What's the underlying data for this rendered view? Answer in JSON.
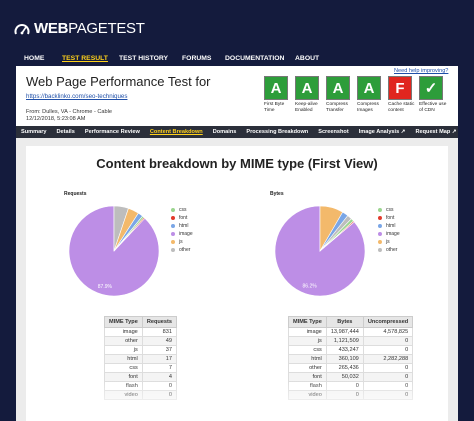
{
  "header": {
    "logo_text_web": "WEB",
    "logo_text_pagetest": "PAGETEST",
    "nav": [
      "HOME",
      "TEST RESULT",
      "TEST HISTORY",
      "FORUMS",
      "DOCUMENTATION",
      "ABOUT"
    ],
    "nav_active_index": 1
  },
  "test": {
    "title": "Web Page Performance Test for",
    "url": "https://backlinko.com/seo-techniques",
    "from_line1": "From: Dulles, VA - Chrome - Cable",
    "from_line2": "12/12/2018, 5:23:08 AM",
    "help_link": "Need help improving?"
  },
  "grades": [
    {
      "letter": "A",
      "label": "First Byte Time",
      "color": "#2d9d3a"
    },
    {
      "letter": "A",
      "label": "Keep-alive Enabled",
      "color": "#2d9d3a"
    },
    {
      "letter": "A",
      "label": "Compress Transfer",
      "color": "#2d9d3a"
    },
    {
      "letter": "A",
      "label": "Compress Images",
      "color": "#2d9d3a"
    },
    {
      "letter": "F",
      "label": "Cache static content",
      "color": "#e0261f"
    },
    {
      "letter": "✓",
      "label": "Effective use of CDN",
      "color": "#2d9d3a"
    }
  ],
  "subnav": [
    "Summary",
    "Details",
    "Performance Review",
    "Content Breakdown",
    "Domains",
    "Processing Breakdown",
    "Screenshot",
    "Image Analysis ↗",
    "Request Map ↗"
  ],
  "subnav_active_index": 3,
  "page_title": "Content breakdown by MIME type (First View)",
  "colors": {
    "css": "#9bd58f",
    "font": "#e23a2c",
    "html": "#7aa6e6",
    "image": "#bd8ee6",
    "js": "#f3b96b",
    "other": "#bdbdbd"
  },
  "legend": [
    "css",
    "font",
    "html",
    "image",
    "js",
    "other"
  ],
  "chart_data": [
    {
      "type": "pie",
      "title": "Requests",
      "slices": [
        {
          "label": "image",
          "value": 87.9,
          "shown": "87.9%"
        },
        {
          "label": "other",
          "value": 5.2
        },
        {
          "label": "js",
          "value": 3.9
        },
        {
          "label": "html",
          "value": 1.8
        },
        {
          "label": "css",
          "value": 0.7
        },
        {
          "label": "font",
          "value": 0.4
        }
      ]
    },
    {
      "type": "pie",
      "title": "Bytes",
      "slices": [
        {
          "label": "image",
          "value": 86.2,
          "shown": "86.2%"
        },
        {
          "label": "js",
          "value": 8.4
        },
        {
          "label": "html",
          "value": 2.2
        },
        {
          "label": "other",
          "value": 1.7
        },
        {
          "label": "css",
          "value": 1.1
        },
        {
          "label": "font",
          "value": 0.4
        }
      ]
    }
  ],
  "requests_table": {
    "headers": [
      "MIME Type",
      "Requests"
    ],
    "rows": [
      [
        "image",
        "831"
      ],
      [
        "other",
        "49"
      ],
      [
        "js",
        "37"
      ],
      [
        "html",
        "17"
      ],
      [
        "css",
        "7"
      ],
      [
        "font",
        "4"
      ],
      [
        "flash",
        "0"
      ],
      [
        "video",
        "0"
      ]
    ]
  },
  "bytes_table": {
    "headers": [
      "MIME Type",
      "Bytes",
      "Uncompressed"
    ],
    "rows": [
      [
        "image",
        "13,987,444",
        "4,578,825"
      ],
      [
        "js",
        "1,121,509",
        "0"
      ],
      [
        "css",
        "433,247",
        "0"
      ],
      [
        "html",
        "360,109",
        "2,282,288"
      ],
      [
        "other",
        "265,436",
        "0"
      ],
      [
        "font",
        "50,032",
        "0"
      ],
      [
        "flash",
        "0",
        "0"
      ],
      [
        "video",
        "0",
        "0"
      ]
    ]
  }
}
